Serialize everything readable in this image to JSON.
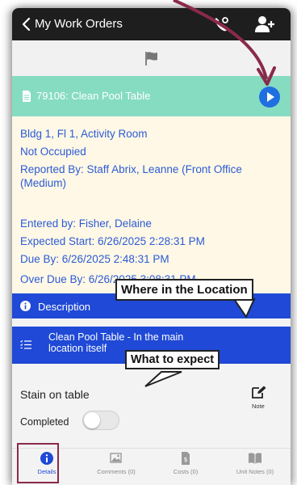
{
  "navbar": {
    "title": "My Work Orders",
    "back_icon": "chevron-left-icon",
    "phone_icon": "phone-settings-icon",
    "add_user_icon": "add-user-icon"
  },
  "flag_icon": "flag-icon",
  "work_order": {
    "title": "79106: Clean Pool Table",
    "header_color": "#86dcc1",
    "play_color": "#1f6fe0"
  },
  "details": {
    "location": "Bldg 1, Fl 1, Activity Room",
    "occupancy": "Not Occupied",
    "reported_by_line1": "Reported By: Staff Abrix, Leanne (Front Office",
    "reported_by_line2": "(Medium)",
    "entered_by": "Entered by: Fisher, Delaine",
    "expected_start": "Expected Start: 6/26/2025 2:28:31 PM",
    "due_by": "Due By: 6/26/2025 2:48:31 PM",
    "over_due_by": "Over Due By: 6/26/2025 3:08:31 PM"
  },
  "description": {
    "label": "Description",
    "bar_color": "#1f49d6"
  },
  "task": {
    "line1": "Clean Pool Table - In the main",
    "line2": "location itself"
  },
  "note": {
    "text": "Stain on table",
    "label": "Note"
  },
  "completed": {
    "label": "Completed",
    "value": false
  },
  "tabs": [
    {
      "label": "Details",
      "icon": "info-icon"
    },
    {
      "label": "Comments (0)",
      "icon": "image-icon"
    },
    {
      "label": "Costs (0)",
      "icon": "cost-document-icon"
    },
    {
      "label": "Unit Notes (0)",
      "icon": "book-icon"
    }
  ],
  "callouts": {
    "location": "Where in the Location",
    "expect": "What to expect"
  },
  "accent_color": "#8a2a4a"
}
